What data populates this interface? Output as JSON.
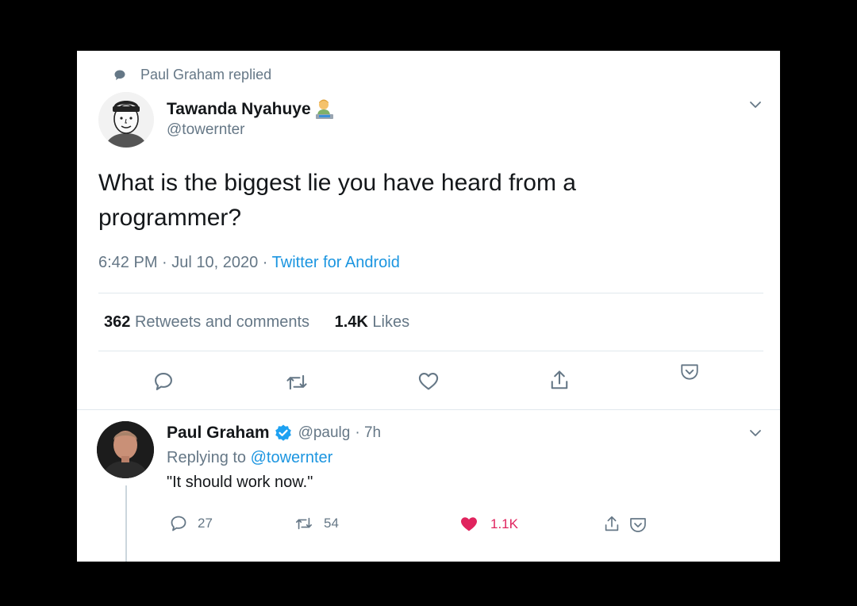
{
  "original_tweet": {
    "social_context": "Paul Graham replied",
    "author_name": "Tawanda Nyahuye",
    "author_handle": "@towernter",
    "text": "What is the biggest lie you have heard from a programmer?",
    "time": "6:42 PM · Jul 10, 2020 · ",
    "source": "Twitter for Android",
    "retweets_count": "362",
    "retweets_label": "Retweets and comments",
    "likes_count": "1.4K",
    "likes_label": "Likes"
  },
  "reply_tweet": {
    "author_name": "Paul Graham",
    "author_handle": "@paulg",
    "time_ago": "· 7h",
    "replying_prefix": "Replying to ",
    "replying_handle": "@towernter",
    "text": "\"It should work now.\"",
    "reply_count": "27",
    "retweet_count": "54",
    "like_count": "1.1K"
  },
  "colors": {
    "link_blue": "#1b95e0",
    "like_red": "#e0245e",
    "verified_blue": "#1da1f2",
    "muted_gray": "#657786"
  },
  "icons": {
    "social_context": "speech-bubble-icon",
    "author_badge": "laptop-person-emoji-icon",
    "menu": "chevron-down-icon",
    "reply": "reply-icon",
    "retweet": "retweet-icon",
    "like": "heart-icon",
    "share": "share-icon",
    "bookmark": "pocket-icon",
    "verified": "verified-badge-icon"
  }
}
